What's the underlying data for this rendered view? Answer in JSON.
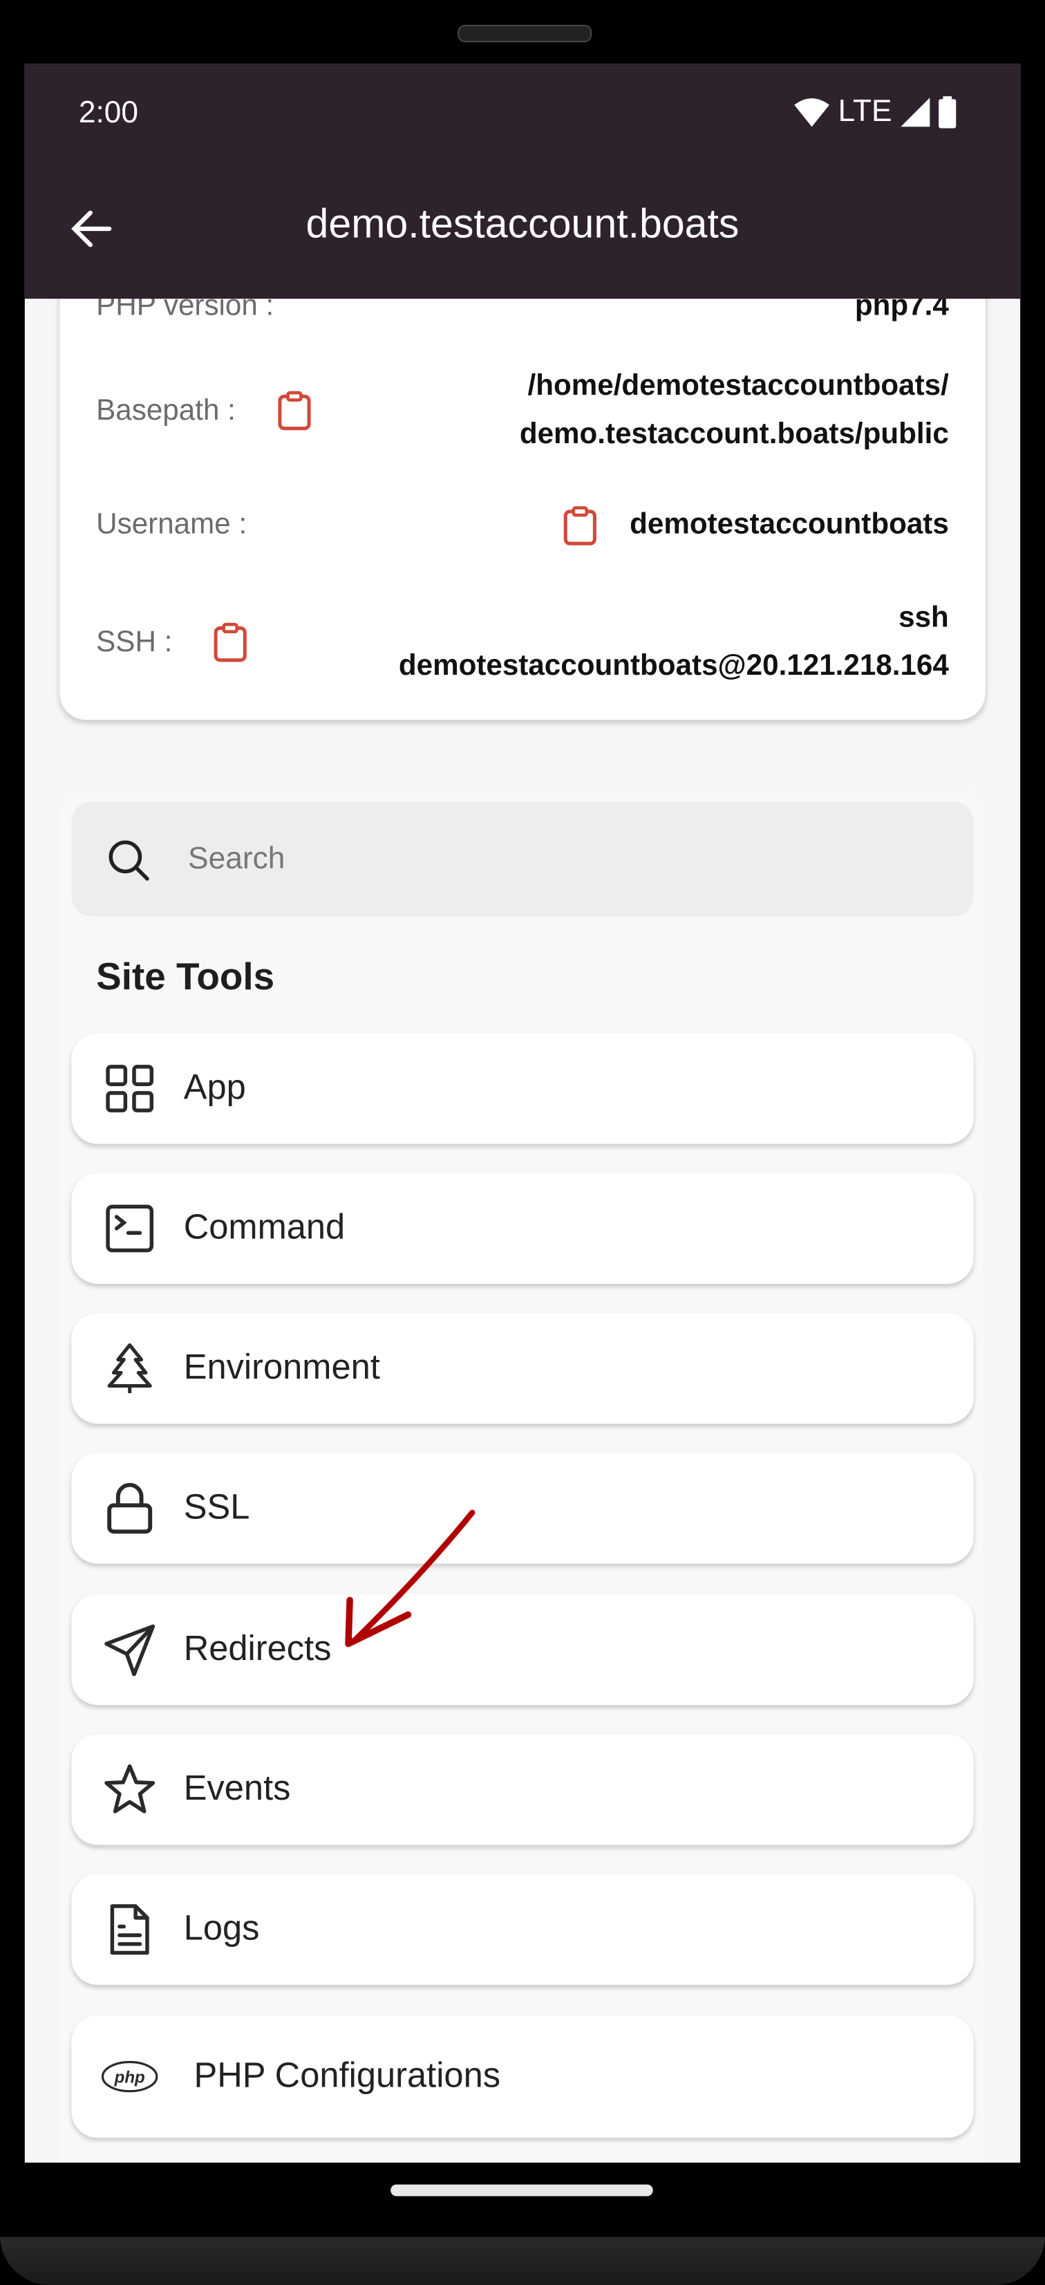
{
  "status_bar": {
    "time": "2:00",
    "network": "LTE",
    "icons": [
      "wifi-icon",
      "signal-icon",
      "battery-icon"
    ]
  },
  "app_bar": {
    "title": "demo.testaccount.boats",
    "back_icon": "arrow-left-icon"
  },
  "site_info": {
    "php_version_label": "PHP version :",
    "php_version_value": "php7.4",
    "basepath_label": "Basepath :",
    "basepath_value_line1": "/home/demotestaccountboats/",
    "basepath_value_line2": "demo.testaccount.boats/public",
    "username_label": "Username :",
    "username_value": "demotestaccountboats",
    "ssh_label": "SSH :",
    "ssh_value_line1": "ssh",
    "ssh_value_line2": "demotestaccountboats@20.121.218.164",
    "copy_icon": "clipboard-icon",
    "copy_icon_color": "#d04a3a"
  },
  "search": {
    "placeholder": "Search"
  },
  "site_tools": {
    "heading": "Site Tools",
    "items": [
      {
        "label": "App",
        "icon": "grid-icon"
      },
      {
        "label": "Command",
        "icon": "terminal-icon"
      },
      {
        "label": "Environment",
        "icon": "tree-icon"
      },
      {
        "label": "SSL",
        "icon": "lock-icon"
      },
      {
        "label": "Redirects",
        "icon": "send-icon"
      },
      {
        "label": "Events",
        "icon": "star-icon"
      },
      {
        "label": "Logs",
        "icon": "document-icon"
      },
      {
        "label": "PHP Configurations",
        "icon": "php-icon"
      }
    ]
  },
  "annotation": {
    "color": "#b00000",
    "points_to": "Redirects"
  },
  "colors": {
    "app_bar": "#2e222d",
    "background": "#f6f6f6"
  }
}
